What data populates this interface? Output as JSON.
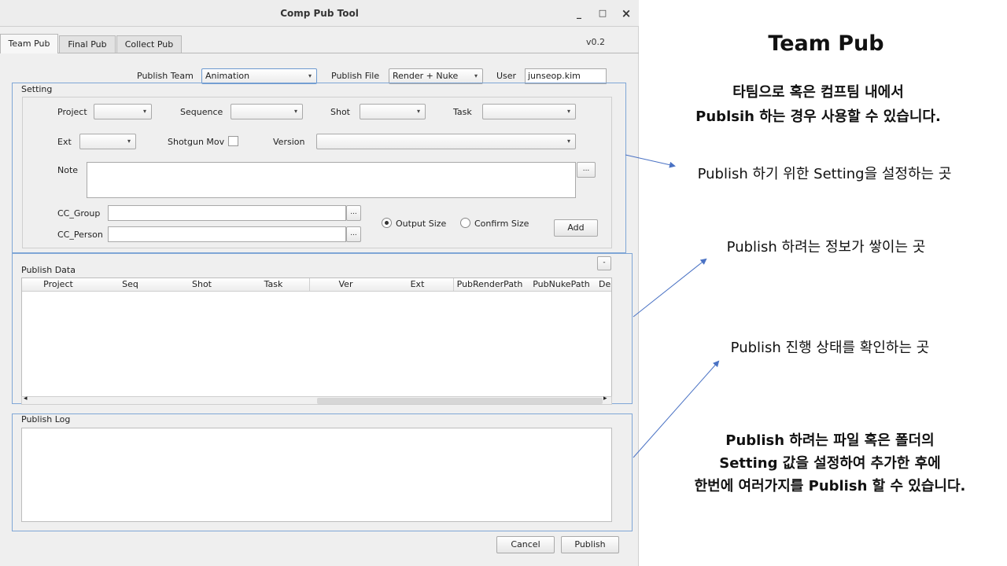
{
  "window": {
    "title": "Comp Pub Tool",
    "min": "_",
    "max": "□",
    "close": "×"
  },
  "tabs": [
    {
      "label": "Team Pub"
    },
    {
      "label": "Final Pub"
    },
    {
      "label": "Collect Pub"
    }
  ],
  "version": "v0.2",
  "header": {
    "publish_team_label": "Publish Team",
    "publish_team_value": "Animation",
    "publish_file_label": "Publish File",
    "publish_file_value": "Render + Nuke",
    "user_label": "User",
    "user_value": "junseop.kim"
  },
  "setting": {
    "title": "Setting",
    "project_label": "Project",
    "sequence_label": "Sequence",
    "shot_label": "Shot",
    "task_label": "Task",
    "ext_label": "Ext",
    "shotgun_mov_label": "Shotgun Mov",
    "version_label": "Version",
    "note_label": "Note",
    "more_label": "...",
    "cc_group_label": "CC_Group",
    "cc_person_label": "CC_Person",
    "output_size_label": "Output Size",
    "confirm_size_label": "Confirm Size",
    "add_label": "Add"
  },
  "publish_data": {
    "title": "Publish Data",
    "collapse_label": "-",
    "columns": [
      "Project",
      "Seq",
      "Shot",
      "Task",
      "Ver",
      "Ext",
      "PubRenderPath",
      "PubNukePath",
      "De"
    ],
    "scroll_left": "◂",
    "scroll_right": "▸"
  },
  "publish_log": {
    "title": "Publish Log"
  },
  "footer": {
    "cancel_label": "Cancel",
    "publish_label": "Publish"
  },
  "annotations": {
    "title": "Team Pub",
    "intro_1": "타팀으로 혹은 컴프팀 내에서",
    "intro_2": "Publsih 하는 경우 사용할 수 있습니다.",
    "setting_note": "Publish 하기 위한 Setting을 설정하는 곳",
    "data_note": "Publish 하려는 정보가 쌓이는 곳",
    "log_note": "Publish 진행 상태를 확인하는 곳",
    "summary_1": "Publish 하려는 파일 혹은 폴더의",
    "summary_2": "Setting 값을 설정하여 추가한 후에",
    "summary_3": "한번에 여러가지를 Publish 할 수 있습니다."
  },
  "colors": {
    "highlight": "#7fa6d6",
    "arrow": "#4a72c4",
    "window_bg": "#efefef"
  },
  "icons": {
    "combo_arrow": "▾"
  }
}
